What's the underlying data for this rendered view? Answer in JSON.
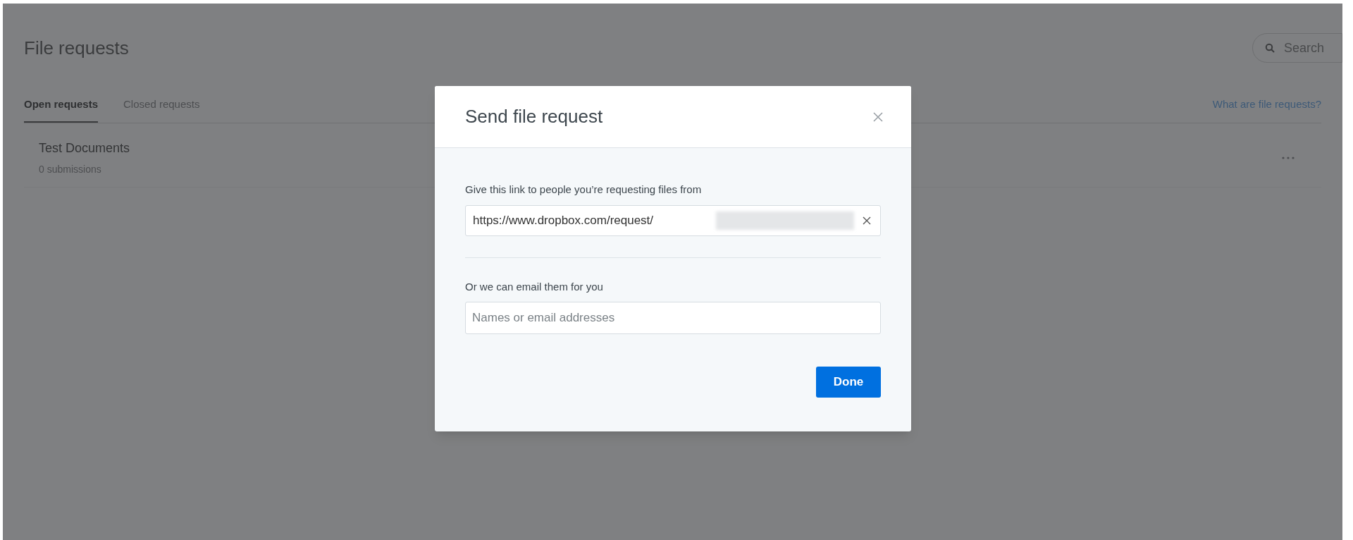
{
  "page": {
    "title": "File requests",
    "search": {
      "placeholder": "Search"
    },
    "tabs": [
      {
        "label": "Open requests",
        "selected": true
      },
      {
        "label": "Closed requests",
        "selected": false
      }
    ],
    "help_link": "What are file requests?",
    "requests": [
      {
        "name": "Test Documents",
        "submissions": "0 submissions"
      }
    ]
  },
  "dialog": {
    "title": "Send file request",
    "link_label": "Give this link to people you’re requesting files from",
    "link_value": "https://www.dropbox.com/request/",
    "email_label": "Or we can email them for you",
    "email_placeholder": "Names or email addresses",
    "done_button": "Done"
  }
}
